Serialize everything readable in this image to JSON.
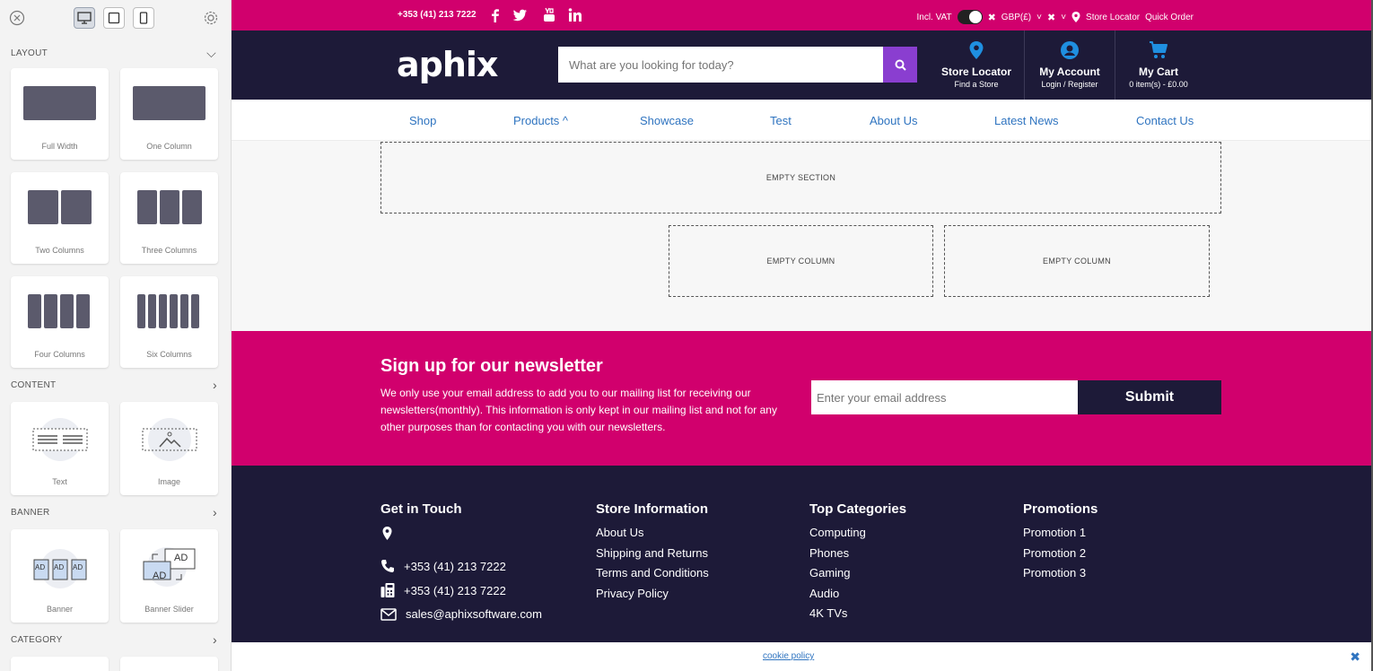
{
  "panel": {
    "sections": {
      "layout": "LAYOUT",
      "content": "CONTENT",
      "banner": "BANNER",
      "category": "CATEGORY"
    },
    "layout_items": [
      "Full Width",
      "One Column",
      "Two Columns",
      "Three Columns",
      "Four Columns",
      "Six Columns"
    ],
    "content_items": [
      "Text",
      "Image"
    ],
    "banner_items": [
      "Banner",
      "Banner Slider"
    ],
    "banner_ad": "AD"
  },
  "topbar": {
    "phone": "+353 (41) 213 7222",
    "vat": "Incl. VAT",
    "currency": "GBP(£)",
    "store_locator": "Store Locator",
    "quick_order": "Quick Order"
  },
  "header": {
    "logo": "aphix",
    "search_placeholder": "What are you looking for today?",
    "store_locator": {
      "title": "Store Locator",
      "sub": "Find a Store"
    },
    "account": {
      "title": "My Account",
      "sub": "Login / Register"
    },
    "cart": {
      "title": "My Cart",
      "sub": "0 item(s) - £0.00"
    }
  },
  "nav": [
    "Shop",
    "Products ^",
    "Showcase",
    "Test",
    "About Us",
    "Latest News",
    "Contact Us"
  ],
  "builder": {
    "empty_section": "EMPTY SECTION",
    "empty_column": "EMPTY COLUMN"
  },
  "newsletter": {
    "title": "Sign up for our newsletter",
    "text": "We only use your email address to add you to our mailing list for receiving our newsletters(monthly). This information is only kept in our mailing list and not for any other purposes than for contacting you with our newsletters.",
    "placeholder": "Enter your email address",
    "button": "Submit"
  },
  "footer": {
    "contact": {
      "title": "Get in Touch",
      "phone": "+353 (41) 213 7222",
      "fax": "+353 (41) 213 7222",
      "email": "sales@aphixsoftware.com"
    },
    "store_info": {
      "title": "Store Information",
      "links": [
        "About Us",
        "Shipping and Returns",
        "Terms and Conditions",
        "Privacy Policy"
      ]
    },
    "top_categories": {
      "title": "Top Categories",
      "links": [
        "Computing",
        "Phones",
        "Gaming",
        "Audio",
        "4K TVs"
      ]
    },
    "promotions": {
      "title": "Promotions",
      "links": [
        "Promotion 1",
        "Promotion 2",
        "Promotion 3"
      ]
    }
  },
  "cookie": {
    "link": "cookie policy"
  },
  "colors": {
    "brand_pink": "#d1006d",
    "navy": "#1d1a38",
    "accent_purple": "#8a3ed0",
    "link_blue": "#2f74c0"
  }
}
